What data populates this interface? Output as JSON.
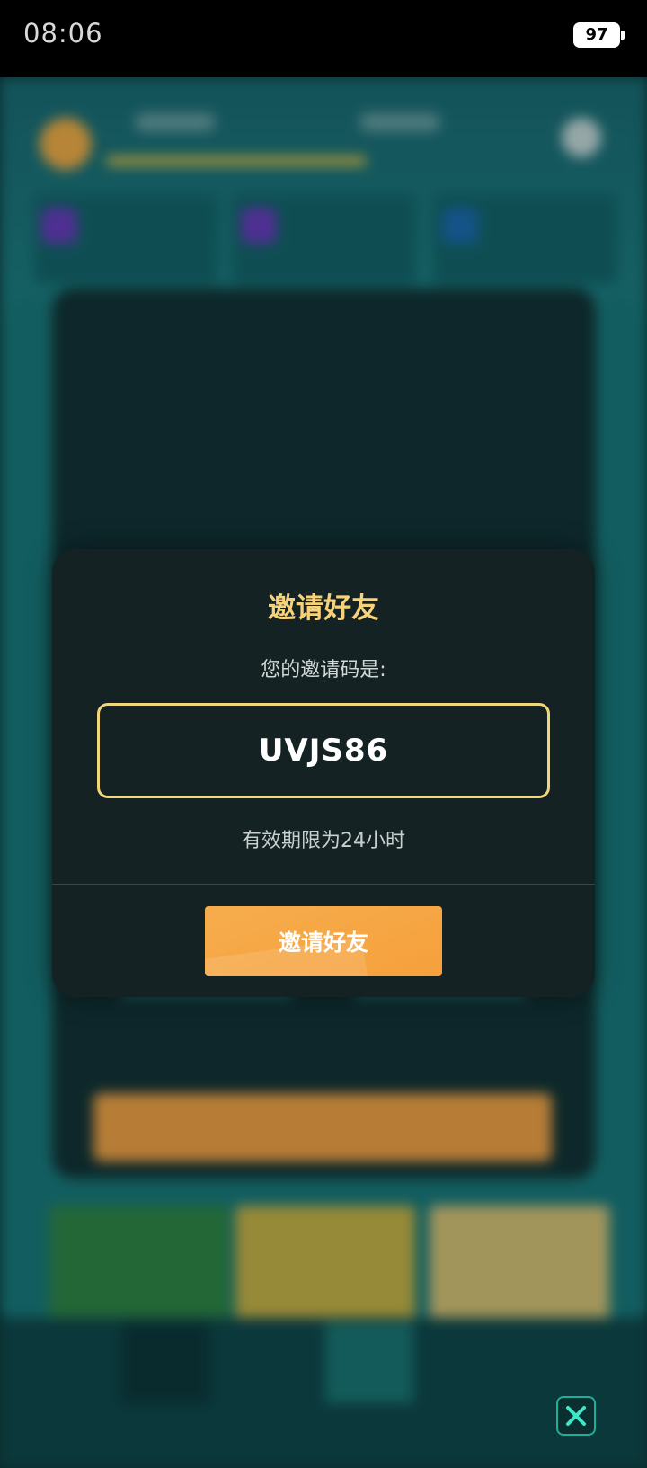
{
  "status_bar": {
    "time": "08:06",
    "battery": "97"
  },
  "dialog": {
    "title": "邀请好友",
    "code_label": "您的邀请码是:",
    "invite_code": "UVJS86",
    "validity": "有效期限为24小时",
    "invite_button": "邀请好友"
  },
  "colors": {
    "title_gold": "#f6d27a",
    "code_border": "#f2d57c",
    "button_orange": "#f5a03c",
    "dialog_bg": "#152223"
  },
  "icons": {
    "close": "close-x-icon"
  }
}
